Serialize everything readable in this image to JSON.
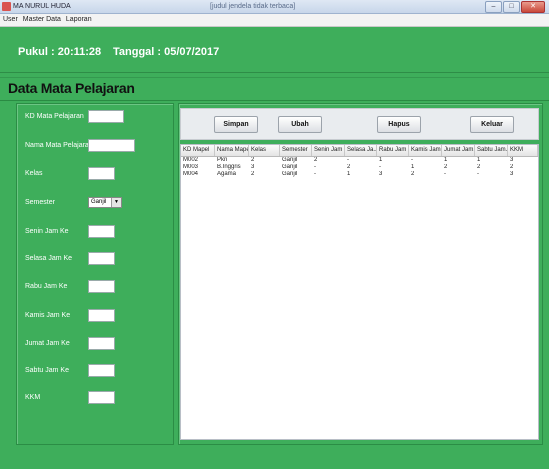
{
  "window": {
    "title": "MA NURUL HUDA",
    "center_title": "[judul jendela tidak terbaca]",
    "controls": {
      "minimize": "–",
      "maximize": "□",
      "close": "✕"
    }
  },
  "menu": [
    "User",
    "Master Data",
    "Laporan"
  ],
  "header": {
    "clock": "Pukul : 20:11:28",
    "date": "Tanggal : 05/07/2017"
  },
  "page_title": "Data Mata Pelajaran",
  "form": {
    "fields": [
      {
        "label": "KD Mata Pelajaran",
        "value": ""
      },
      {
        "label": "Nama Mata Pelajaran",
        "value": ""
      },
      {
        "label": "Kelas",
        "value": ""
      },
      {
        "label": "Semester",
        "value": "Ganjil"
      },
      {
        "label": "Senin Jam Ke",
        "value": ""
      },
      {
        "label": "Selasa Jam Ke",
        "value": ""
      },
      {
        "label": "Rabu Jam Ke",
        "value": ""
      },
      {
        "label": "Kamis Jam Ke",
        "value": ""
      },
      {
        "label": "Jumat Jam Ke",
        "value": ""
      },
      {
        "label": "Sabtu Jam Ke",
        "value": ""
      },
      {
        "label": "KKM",
        "value": ""
      }
    ],
    "semester_arrow": "▼"
  },
  "buttons": {
    "save": "Simpan",
    "edit": "Ubah",
    "delete": "Hapus",
    "exit": "Keluar"
  },
  "table": {
    "columns": [
      "KD Mapel",
      "Nama Mapel",
      "Kelas",
      "Semester",
      "Senin Jam ...",
      "Selasa Ja...",
      "Rabu Jam ...",
      "Kamis Jam...",
      "Jumat Jam...",
      "Sabtu Jam...",
      "KKM"
    ],
    "rows": [
      [
        "M002",
        "Pkn",
        "2",
        "Ganjil",
        "2",
        "-",
        "1",
        "-",
        "1",
        "1",
        "3"
      ],
      [
        "M003",
        "B.Inggris",
        "3",
        "Ganjil",
        "-",
        "2",
        "-",
        "1",
        "2",
        "2",
        "2"
      ],
      [
        "M004",
        "Agama",
        "2",
        "Ganjil",
        "-",
        "1",
        "3",
        "2",
        "-",
        "-",
        "3"
      ]
    ]
  },
  "colors": {
    "background": "#3eae5b",
    "panel_border": "#2b8d45",
    "text_light": "#ffffff"
  }
}
